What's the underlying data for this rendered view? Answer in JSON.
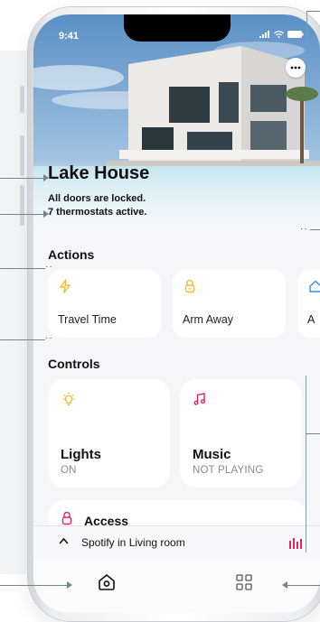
{
  "status_bar": {
    "time": "9:41",
    "icons": [
      "signal-icon",
      "wifi-icon",
      "battery-icon"
    ]
  },
  "home": {
    "name": "Lake House",
    "status_line_1": "All doors are locked.",
    "status_line_2": "7 thermostats active."
  },
  "actions": {
    "title": "Actions",
    "items": [
      {
        "label": "Travel Time",
        "icon": "lightning-icon",
        "icon_color": "#f5b82e"
      },
      {
        "label": "Arm Away",
        "icon": "lock-icon",
        "icon_color": "#f5b82e"
      },
      {
        "label": "A",
        "icon": "home-icon",
        "icon_color": "#3a8de0"
      }
    ]
  },
  "controls": {
    "title": "Controls",
    "items": [
      {
        "name": "Lights",
        "state": "ON",
        "icon": "lightbulb-icon",
        "icon_color": "#f5b82e"
      },
      {
        "name": "Music",
        "state": "NOT PLAYING",
        "icon": "music-note-icon",
        "icon_color": "#e0245e"
      },
      {
        "name": "Access",
        "icon": "lock-icon",
        "icon_color": "#e0245e"
      }
    ]
  },
  "now_playing": {
    "label": "Spotify in Living room",
    "accent": "#e0245e"
  },
  "tabbar": {
    "tabs": [
      {
        "name": "home-tab",
        "icon": "home-icon"
      },
      {
        "name": "grid-tab",
        "icon": "grid-icon"
      }
    ]
  },
  "colors": {
    "background": "#f6f6f8",
    "card": "#ffffff",
    "accent_yellow": "#f5b82e",
    "accent_red": "#e0245e",
    "annotation": "#6f8791"
  }
}
